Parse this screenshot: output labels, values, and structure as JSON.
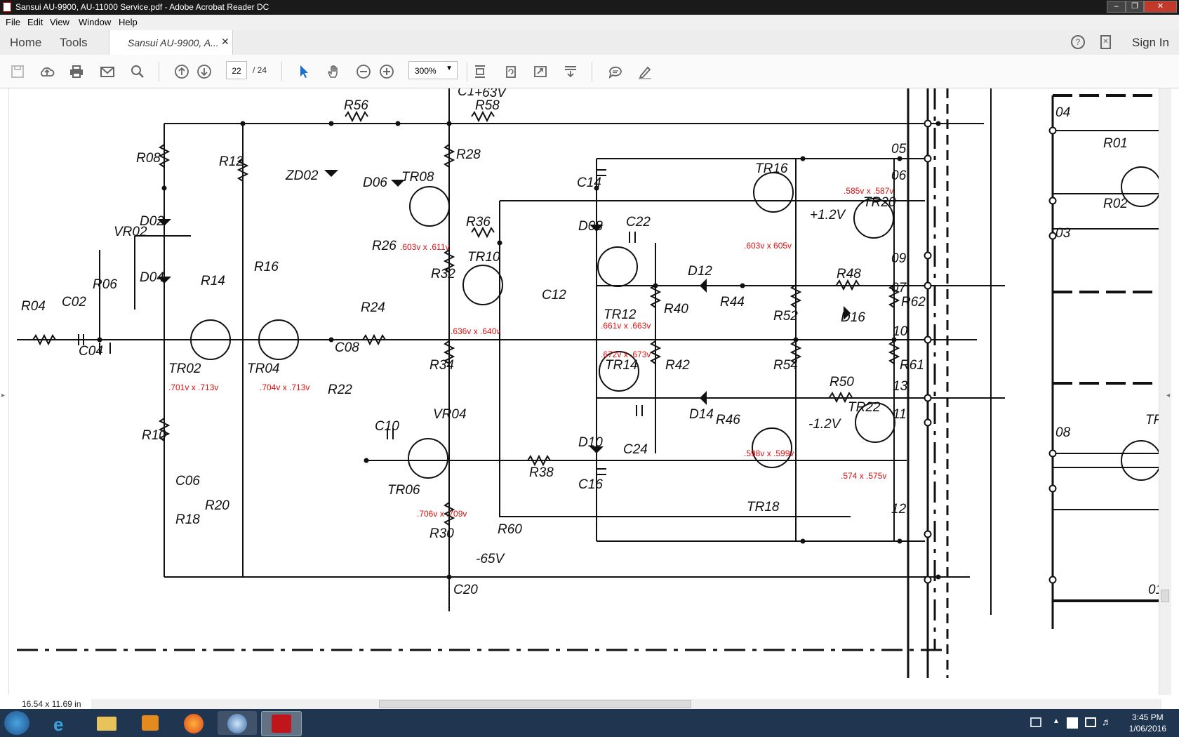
{
  "window": {
    "title": "Sansui AU-9900, AU-11000 Service.pdf - Adobe Acrobat Reader DC"
  },
  "menu": [
    "File",
    "Edit",
    "View",
    "Window",
    "Help"
  ],
  "nav": {
    "home": "Home",
    "tools": "Tools",
    "doc_tab": "Sansui AU-9900, A...",
    "sign_in": "Sign In"
  },
  "toolbar": {
    "page_current": "22",
    "page_total": "/ 24",
    "zoom": "300%"
  },
  "status": {
    "page_size": "16.54 x 11.69 in"
  },
  "clock": {
    "time": "3:45 PM",
    "date": "1/06/2016"
  },
  "schematic": {
    "labels": [
      "R04",
      "C02",
      "C04",
      "R06",
      "VR02",
      "R08",
      "D02",
      "D04",
      "R10",
      "R18",
      "C06",
      "R20",
      "R14",
      "R12",
      "R16",
      "TR02",
      "TR04",
      "ZD02",
      "R22",
      "C08",
      "R24",
      "R56",
      "D06",
      "R26",
      "TR08",
      "R28",
      "+63V",
      "C1",
      "R58",
      "R36",
      "R32",
      "TR10",
      "C12",
      "R34",
      "VR04",
      "C10",
      "TR06",
      "R30",
      "C20",
      "R60",
      "-65V",
      "R38",
      "C14",
      "D08",
      "C22",
      "TR12",
      "R40",
      "D12",
      "R44",
      "R42",
      "TR14",
      "D14",
      "R46",
      "C24",
      "D10",
      "C16",
      "TR16",
      "+1.2V",
      "TR20",
      "R48",
      "D16",
      "R52",
      "R62",
      "R54",
      "R50",
      "R61",
      "-1.2V",
      "TR22",
      "TR18",
      "05",
      "06",
      "09",
      "07",
      "10",
      "13",
      "11",
      "12",
      "04",
      "03",
      "08",
      "01",
      "R01",
      "R02",
      "TR"
    ],
    "voltages": [
      ".701v x .713v",
      ".704v x .713v",
      ".603v x .611v",
      ".636v x .640v",
      ".706v x .709v",
      ".661v x .663v",
      ".672v x .673v",
      ".603v x 605v",
      ".585v x .587v",
      ".598v x .599v",
      ".574 x .575v"
    ]
  }
}
